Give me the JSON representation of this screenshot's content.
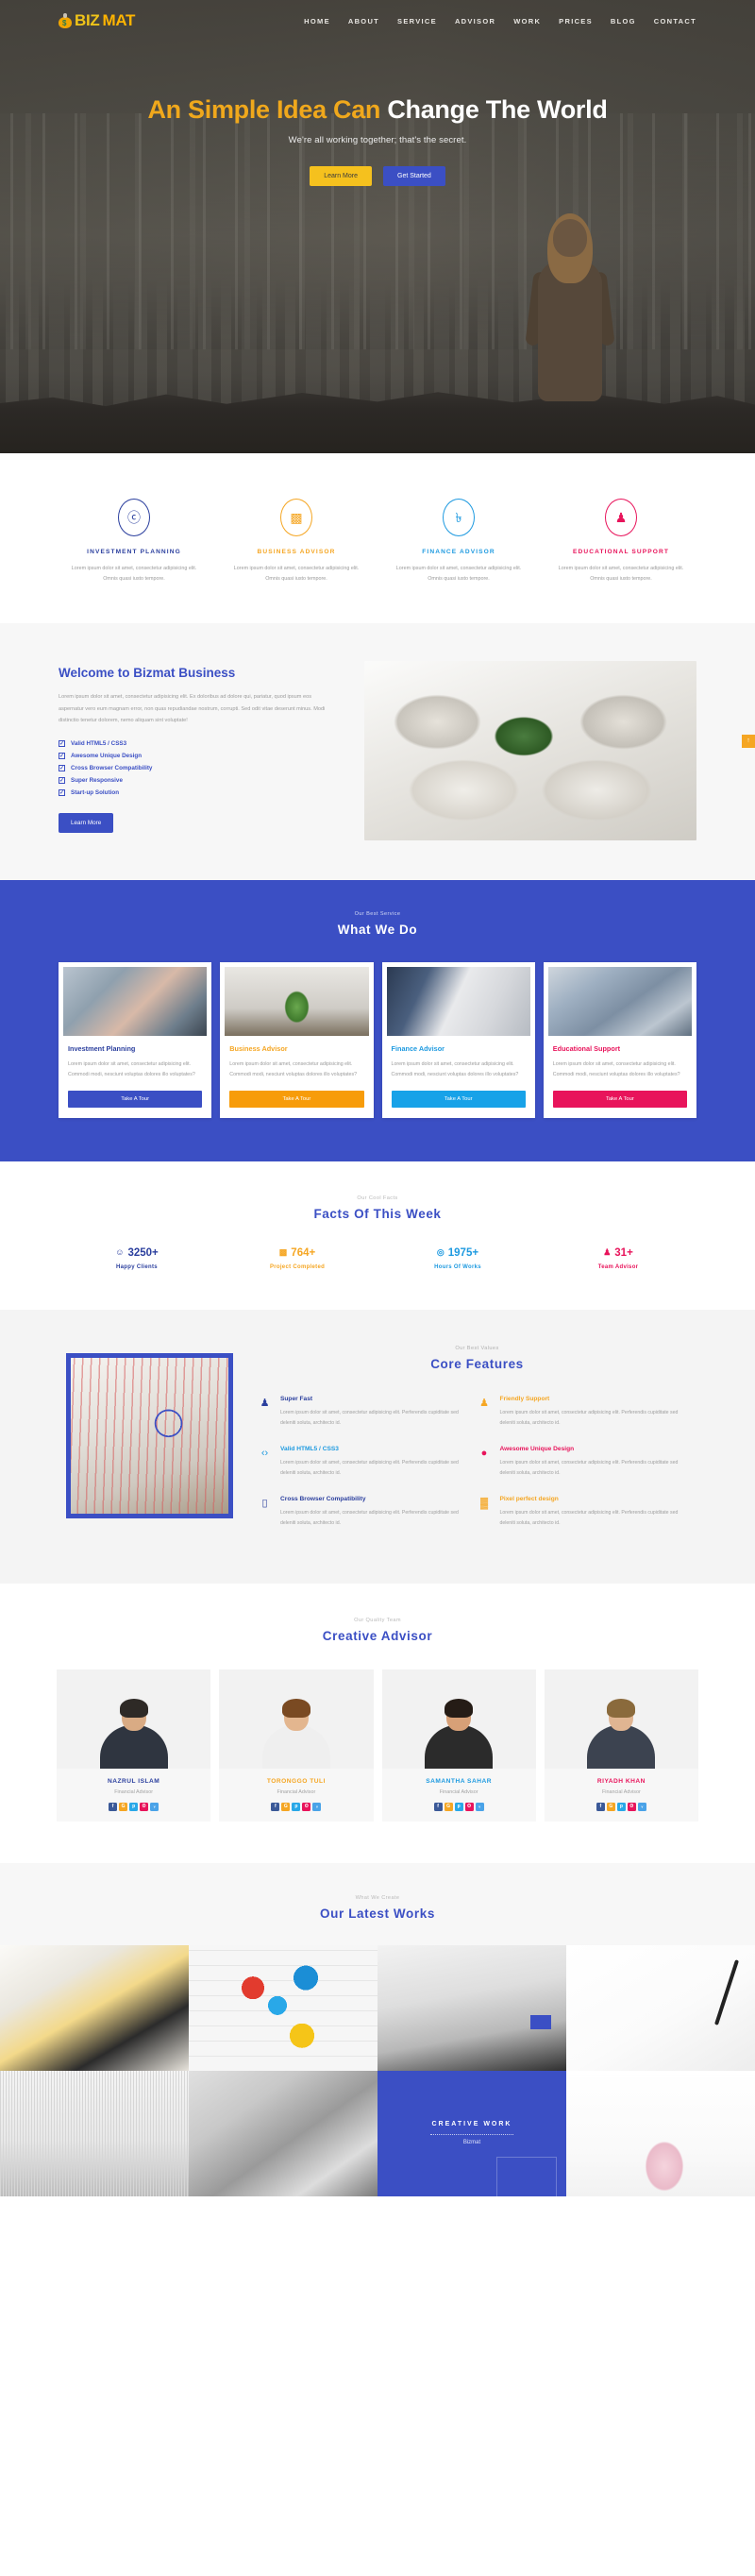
{
  "brand": {
    "logo_icon": "money-bag-icon",
    "name_part1": "BIZ",
    "name_part2": "MAT"
  },
  "nav": {
    "items": [
      {
        "label": "HOME"
      },
      {
        "label": "ABOUT"
      },
      {
        "label": "SERVICE"
      },
      {
        "label": "ADVISOR"
      },
      {
        "label": "WORK"
      },
      {
        "label": "PRICES"
      },
      {
        "label": "BLOG"
      },
      {
        "label": "CONTACT"
      }
    ]
  },
  "hero": {
    "title_highlight": "An Simple Idea Can",
    "title_rest": "Change The World",
    "subtitle": "We're all working together; that's the secret.",
    "btn_primary": "Learn More",
    "btn_secondary": "Get Started",
    "color_primary": "#f5c11e",
    "color_secondary": "#3b4fc4"
  },
  "services": [
    {
      "title": "INVESTMENT PLANNING",
      "icon": "money-document-icon",
      "glyph": "Ⓢ",
      "color": "#2b3f9e",
      "text": "Lorem ipsum dolor sit amet, consectetur adipisicing elit. Omnis quasi iusto tempore."
    },
    {
      "title": "BUSINESS ADVISOR",
      "icon": "bar-chart-growth-icon",
      "glyph": "ὌA",
      "color": "#f5a623",
      "text": "Lorem ipsum dolor sit amet, consectetur adipisicing elit. Omnis quasi iusto tempore."
    },
    {
      "title": "FINANCE ADVISOR",
      "icon": "taka-currency-icon",
      "glyph": "৳",
      "color": "#1e9ae0",
      "text": "Lorem ipsum dolor sit amet, consectetur adipisicing elit. Omnis quasi iusto tempore."
    },
    {
      "title": "EDUCATIONAL SUPPORT",
      "icon": "headset-support-icon",
      "glyph": "♟",
      "color": "#e8145b",
      "text": "Lorem ipsum dolor sit amet, consectetur adipisicing elit. Omnis quasi iusto tempore."
    }
  ],
  "welcome": {
    "title": "Welcome to Bizmat Business",
    "text": "Lorem ipsum dolor sit amet, consectetur adipisicing elit. Ex doloribus ad dolore qui, pariatur, quod ipsum eos aspernatur vero eum magnam error, non quas repudiandae nostrum, corrupti. Sed odit vitae deserunt minus. Modi distinctio tenetur dolorem, nemo aliquam sint voluptate!",
    "checklist": [
      "Valid HTML5 / CSS3",
      "Awesome Unique Design",
      "Cross Browser Compatibility",
      "Super Responsive",
      "Start-up Solution"
    ],
    "button": "Learn More",
    "image_alt": "hands-holding-seedling-photo",
    "scroll_tab_icon": "arrow-up-icon"
  },
  "whatwedo": {
    "kicker": "Our Best Service",
    "title": "What We Do",
    "cards": [
      {
        "title": "Investment Planning",
        "color": "#2b3f9e",
        "btn": "Take A Tour",
        "btn_color": "#3b4fc4",
        "text": "Lorem ipsum dolor sit amet, consectetur adipisicing elit. Commodi modi, nesciunt voluptas dolores illo voluptates?"
      },
      {
        "title": "Business Advisor",
        "color": "#f5a623",
        "btn": "Take A Tour",
        "btn_color": "#f79c0a",
        "text": "Lorem ipsum dolor sit amet, consectetur adipisicing elit. Commodi modi, nesciunt voluptas dolores illo voluptates?"
      },
      {
        "title": "Finance Advisor",
        "color": "#1e9ae0",
        "btn": "Take A Tour",
        "btn_color": "#17a2e8",
        "text": "Lorem ipsum dolor sit amet, consectetur adipisicing elit. Commodi modi, nesciunt voluptas dolores illo voluptates?"
      },
      {
        "title": "Educational Support",
        "color": "#e8145b",
        "btn": "Take A Tour",
        "btn_color": "#e8145b",
        "text": "Lorem ipsum dolor sit amet, consectetur adipisicing elit. Commodi modi, nesciunt voluptas dolores illo voluptates?"
      }
    ]
  },
  "facts": {
    "kicker": "Our Cool Facts",
    "title": "Facts Of This Week",
    "items": [
      {
        "value": "3250+",
        "label": "Happy Clients",
        "icon": "smiley-face-icon",
        "glyph": "☺",
        "color": "#2b3f9e"
      },
      {
        "value": "764+",
        "label": "Project Completed",
        "icon": "bar-chart-icon",
        "glyph": "Ὄ8",
        "color": "#f5a623"
      },
      {
        "value": "1975+",
        "label": "Hours Of Works",
        "icon": "clock-icon",
        "glyph": "◎",
        "color": "#1e9ae0"
      },
      {
        "value": "31+",
        "label": "Team Advisor",
        "icon": "people-group-icon",
        "glyph": "♟",
        "color": "#e8145b"
      }
    ]
  },
  "core": {
    "kicker": "Our Best Values",
    "title": "Core Features",
    "image_alt": "business-meeting-charts-photo",
    "features": [
      {
        "title": "Super Fast",
        "color": "#2b3f9e",
        "icon": "runner-icon",
        "glyph": "♟",
        "text": "Lorem ipsum dolor sit amet, consectetur adipisicing elit. Perferendis cupiditate sed deleniti soluta, architecto id."
      },
      {
        "title": "Friendly Support",
        "color": "#f5a623",
        "icon": "support-person-icon",
        "glyph": "♟",
        "text": "Lorem ipsum dolor sit amet, consectetur adipisicing elit. Perferendis cupiditate sed deleniti soluta, architecto id."
      },
      {
        "title": "Valid HTML5 / CSS3",
        "color": "#1e9ae0",
        "icon": "code-brackets-icon",
        "glyph": "‹›",
        "text": "Lorem ipsum dolor sit amet, consectetur adipisicing elit. Perferendis cupiditate sed deleniti soluta, architecto id."
      },
      {
        "title": "Awesome Unique Design",
        "color": "#e8145b",
        "icon": "lightbulb-icon",
        "glyph": "●",
        "text": "Lorem ipsum dolor sit amet, consectetur adipisicing elit. Perferendis cupiditate sed deleniti soluta, architecto id."
      },
      {
        "title": "Cross Browser Compatibility",
        "color": "#2b3f9e",
        "icon": "mobile-device-icon",
        "glyph": "▯",
        "text": "Lorem ipsum dolor sit amet, consectetur adipisicing elit. Perferendis cupiditate sed deleniti soluta, architecto id."
      },
      {
        "title": "Pixel perfect design",
        "color": "#f5a623",
        "icon": "pixels-icon",
        "glyph": "▓",
        "text": "Lorem ipsum dolor sit amet, consectetur adipisicing elit. Perferendis cupiditate sed deleniti soluta, architecto id."
      }
    ]
  },
  "advisor": {
    "kicker": "Our Quality Team",
    "title": "Creative Advisor",
    "members": [
      {
        "name": "NAZRUL ISLAM",
        "role": "Financial Advisor",
        "color": "#2b3f9e",
        "skin": "#d9ab84",
        "hair": "#2e2a26",
        "suit": "#2f3540"
      },
      {
        "name": "TORONGGO TULI",
        "role": "Financial Advisor",
        "color": "#f5a623",
        "skin": "#e3b68f",
        "hair": "#7a4a22",
        "suit": "#efefef"
      },
      {
        "name": "SAMANTHA SAHAR",
        "role": "Financial Advisor",
        "color": "#1e9ae0",
        "skin": "#d7a077",
        "hair": "#251c16",
        "suit": "#2b2b2b"
      },
      {
        "name": "RIYADH KHAN",
        "role": "Financial Advisor",
        "color": "#e8145b",
        "skin": "#e0b592",
        "hair": "#8a6a3c",
        "suit": "#3c4350"
      }
    ],
    "socials": [
      {
        "name": "facebook-icon",
        "glyph": "f",
        "color": "#3b5998"
      },
      {
        "name": "google-plus-icon",
        "glyph": "G",
        "color": "#f5a623"
      },
      {
        "name": "pinterest-icon",
        "glyph": "p",
        "color": "#29a8e8"
      },
      {
        "name": "dribbble-icon",
        "glyph": "ʘ",
        "color": "#e8145b"
      },
      {
        "name": "twitter-icon",
        "glyph": "ᵥ",
        "color": "#4aa3e8"
      }
    ]
  },
  "works": {
    "kicker": "What We Create",
    "title": "Our Latest Works",
    "overlay_title": "CREATIVE WORK",
    "overlay_subtitle": "Bizmat",
    "items": [
      {
        "alt": "blueprint-calculator-tools-photo"
      },
      {
        "alt": "colored-puzzle-pieces-photo"
      },
      {
        "alt": "desk-pencils-books-photo"
      },
      {
        "alt": "hand-writing-pen-photo"
      },
      {
        "alt": "calculator-pen-chart-photo"
      },
      {
        "alt": "smartphone-on-desk-photo"
      },
      {
        "alt": "creative-work-overlay"
      },
      {
        "alt": "pink-shopping-bag-photo"
      }
    ]
  }
}
